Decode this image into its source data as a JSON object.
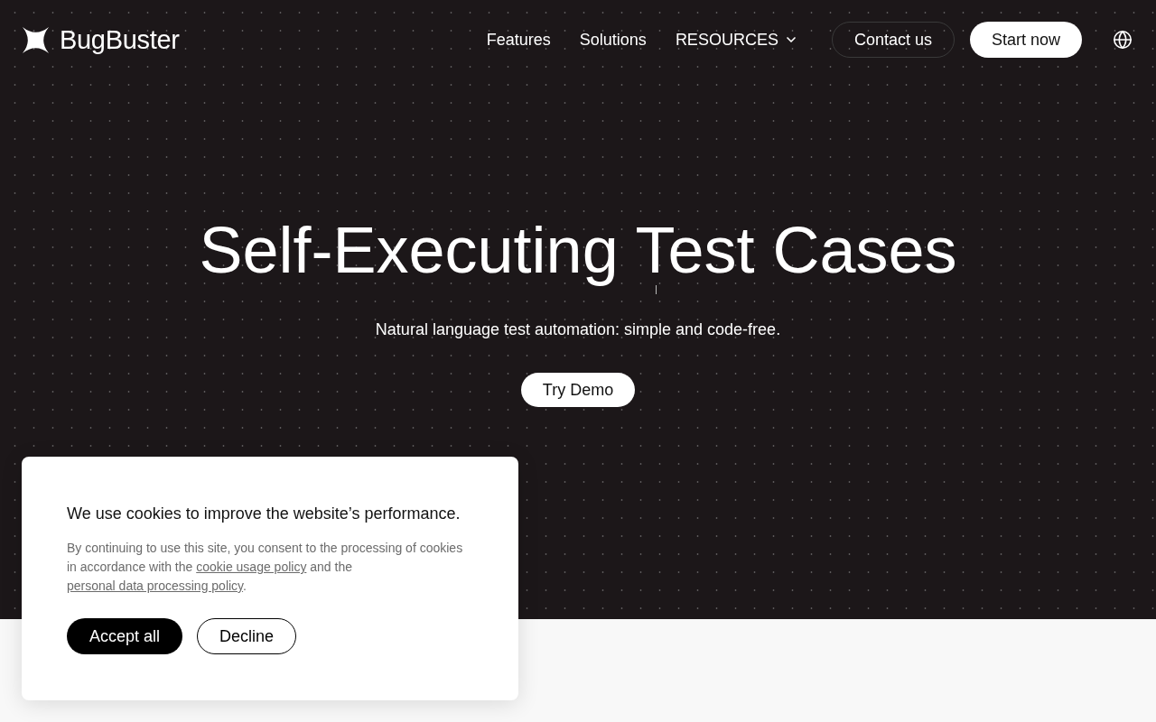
{
  "header": {
    "logo": {
      "name": "BugBuster"
    },
    "nav": [
      {
        "label": "Features",
        "kind": "link"
      },
      {
        "label": "Solutions",
        "kind": "link"
      },
      {
        "label": "RESOURCES",
        "kind": "dropdown"
      }
    ],
    "buttons": [
      {
        "label": "Contact us",
        "kind": "outline"
      },
      {
        "label": "Start now",
        "kind": "solid"
      }
    ]
  },
  "hero": {
    "title": "Self-Executing Test Cases",
    "subtitle": "Natural language test automation: simple and code-free.",
    "button": "Try Demo"
  },
  "cookie_banner": {
    "title": "We use cookies to improve the website’s performance.",
    "text": [
      {
        "kind": "text",
        "text": "By continuing to use this site, you consent to the processing of cookies in accordance with the "
      },
      {
        "kind": "link",
        "text": "cookie usage policy"
      },
      {
        "kind": "text",
        "text": " and the "
      },
      {
        "kind": "link",
        "text": "personal data processing policy"
      },
      {
        "kind": "text",
        "text": "."
      }
    ],
    "buttons": [
      {
        "label": "Accept all",
        "kind": "primary"
      },
      {
        "label": "Decline",
        "kind": "secondary"
      }
    ]
  }
}
